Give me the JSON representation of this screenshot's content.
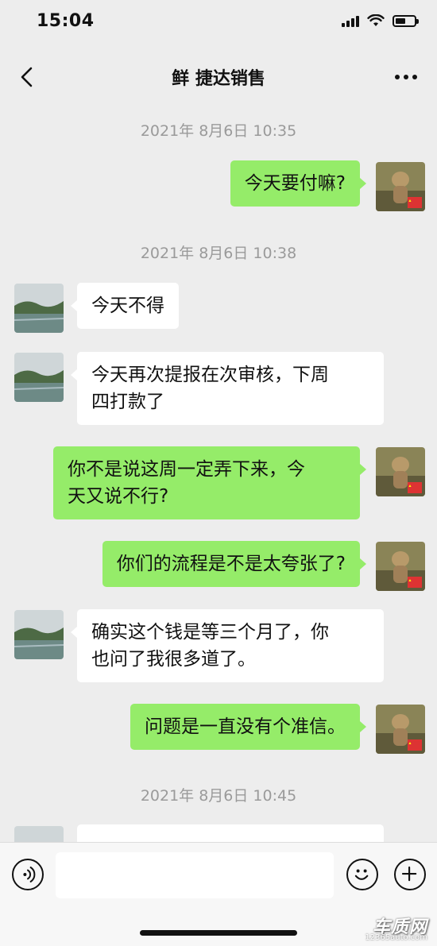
{
  "status_bar": {
    "time": "15:04",
    "battery_level": 0.55
  },
  "nav": {
    "title": "鲜 捷达销售",
    "back_icon": "chevron-left-icon",
    "more_icon": "more-dots-icon"
  },
  "messages": [
    {
      "type": "time",
      "text": "2021年 8月6日 10:35"
    },
    {
      "type": "out",
      "text": "今天要付嘛?"
    },
    {
      "type": "time",
      "text": "2021年 8月6日 10:38"
    },
    {
      "type": "in",
      "text": "今天不得"
    },
    {
      "type": "in",
      "lines": [
        "今天再次提报在次审核，下周",
        "四打款了"
      ]
    },
    {
      "type": "out",
      "lines": [
        "你不是说这周一定弄下来，今",
        "天又说不行?"
      ]
    },
    {
      "type": "out",
      "text": "你们的流程是不是太夸张了?"
    },
    {
      "type": "in",
      "lines": [
        "确实这个钱是等三个月了，你",
        "也问了我很多道了。"
      ]
    },
    {
      "type": "out",
      "text": "问题是一直没有个准信。"
    },
    {
      "type": "time",
      "text": "2021年 8月6日 10:45"
    }
  ],
  "input_bar": {
    "voice_icon": "voice-icon",
    "input_value": "",
    "emoji_icon": "emoji-icon",
    "plus_icon": "plus-icon"
  },
  "watermark": {
    "main": "车质网",
    "sub": "12365auto.com"
  },
  "colors": {
    "outgoing_bubble": "#95ec69",
    "incoming_bubble": "#ffffff",
    "background": "#ededed"
  }
}
